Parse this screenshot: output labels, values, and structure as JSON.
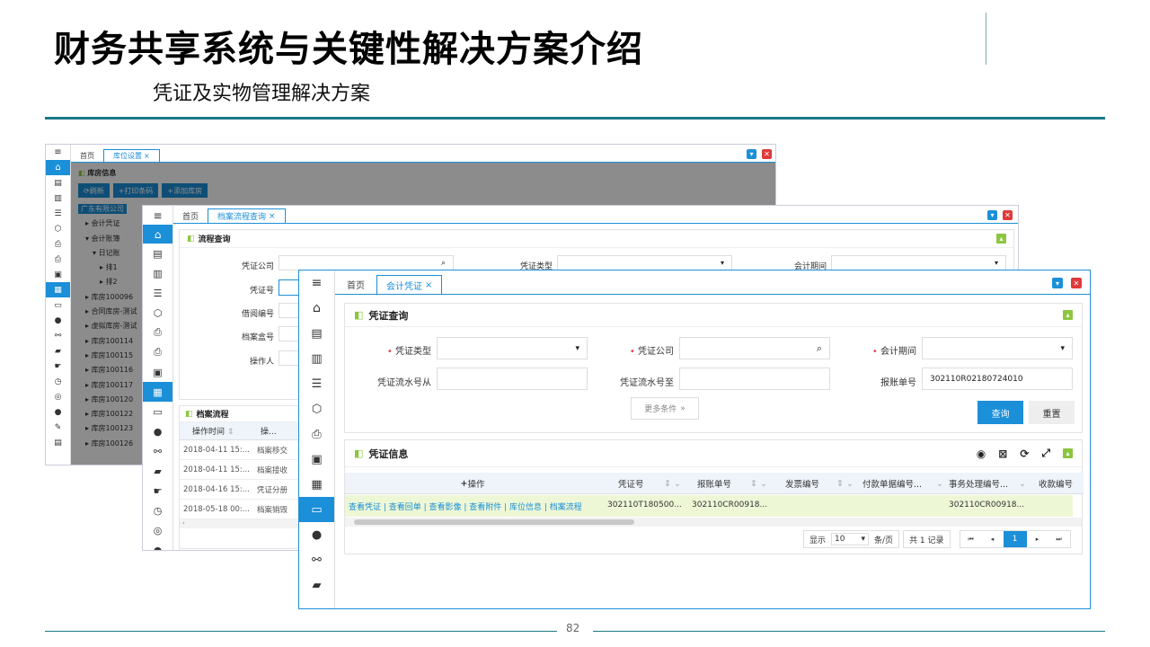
{
  "slide": {
    "title": "财务共享系统与关键性解决方案介绍",
    "subtitle": "凭证及实物管理解决方案",
    "page_number": "82"
  },
  "win1": {
    "tabs": [
      "首页",
      "库位设置"
    ],
    "panel_title": "库房信息",
    "toolbar": [
      "刷新",
      "打印条码",
      "添加库房"
    ],
    "tree": [
      "广东有限公司",
      "会计凭证",
      "会计账簿",
      "日记账",
      "排1",
      "排2",
      "库房100096",
      "合同库房-测试",
      "虚拟库房-测试",
      "库房100114",
      "库房100115",
      "库房100116",
      "库房100117",
      "库房100120",
      "库房100122",
      "库房100123",
      "库房100126"
    ]
  },
  "win2": {
    "tabs": [
      "首页",
      "档案流程查询"
    ],
    "panel_title": "流程查询",
    "labels": [
      "凭证公司",
      "凭证类型",
      "会计期间",
      "凭证号",
      "借阅编号",
      "档案盒号",
      "操作人"
    ],
    "flow_title": "档案流程",
    "columns": [
      "操作时间",
      "操..."
    ],
    "rows": [
      [
        "2018-04-11 15:...",
        "档案移交"
      ],
      [
        "2018-04-11 15:...",
        "档案接收"
      ],
      [
        "2018-04-16 15:...",
        "凭证分册"
      ],
      [
        "2018-05-18 00:...",
        "档案销毁"
      ]
    ]
  },
  "win3": {
    "tabs": [
      "首页",
      "会计凭证"
    ],
    "query_title": "凭证查询",
    "fields": {
      "voucher_type": "凭证类型",
      "voucher_company": "凭证公司",
      "period": "会计期间",
      "serial_from": "凭证流水号从",
      "serial_to": "凭证流水号至",
      "expense_no": "报账单号",
      "expense_no_value": "302110R02180724010"
    },
    "more": "更多条件",
    "query_btn": "查询",
    "reset_btn": "重置",
    "info_title": "凭证信息",
    "columns": [
      "操作",
      "凭证号",
      "报账单号",
      "发票编号",
      "付款单据编号...",
      "事务处理编号...",
      "收款编号"
    ],
    "row_actions": "查看凭证 | 查看回单 | 查看影像 | 查看附件 | 库位信息 | 档案流程",
    "row": [
      "302110T180500...",
      "302110CR00918...",
      "",
      "",
      "302110CR00918..."
    ],
    "pager": {
      "show": "显示",
      "size": "10",
      "per": "条/页",
      "total": "共 1 记录",
      "page": "1"
    }
  }
}
